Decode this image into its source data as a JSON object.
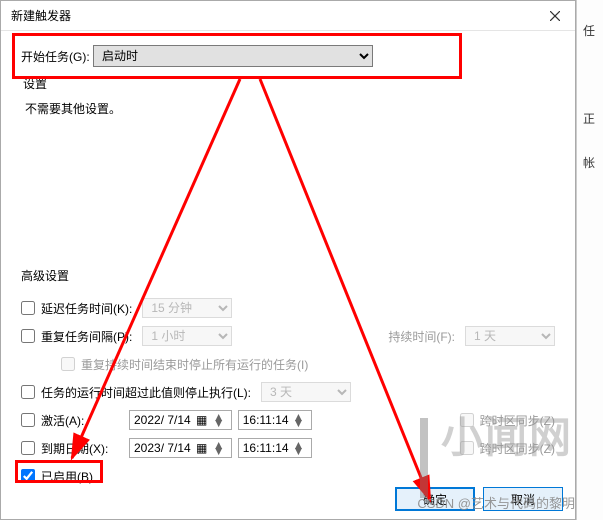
{
  "title": "新建触发器",
  "begin_label": "开始任务(G):",
  "begin_value": "启动时",
  "settings_label": "设置",
  "settings_msg": "不需要其他设置。",
  "advanced_title": "高级设置",
  "delay": {
    "label": "延迟任务时间(K):",
    "value": "15 分钟"
  },
  "repeat": {
    "label": "重复任务间隔(P):",
    "value": "1 小时",
    "dur_label": "持续时间(F):",
    "dur_value": "1 天"
  },
  "repeat_stop": "重复持续时间结束时停止所有运行的任务(I)",
  "stop_after": {
    "label": "任务的运行时间超过此值则停止执行(L):",
    "value": "3 天"
  },
  "activate": {
    "label": "激活(A):",
    "date": "2022/ 7/14",
    "time": "16:11:14",
    "sync": "跨时区同步(Z)"
  },
  "expire": {
    "label": "到期日期(X):",
    "date": "2023/ 7/14",
    "time": "16:11:14",
    "sync": "跨时区同步(Z)"
  },
  "enabled_label": "已启用(B)",
  "ok": "确定",
  "cancel": "取消",
  "rightcol": [
    "任",
    "",
    "正",
    "帐"
  ],
  "wm1": "小闻网",
  "wm2": "CSDN @艺术与代码的黎明"
}
